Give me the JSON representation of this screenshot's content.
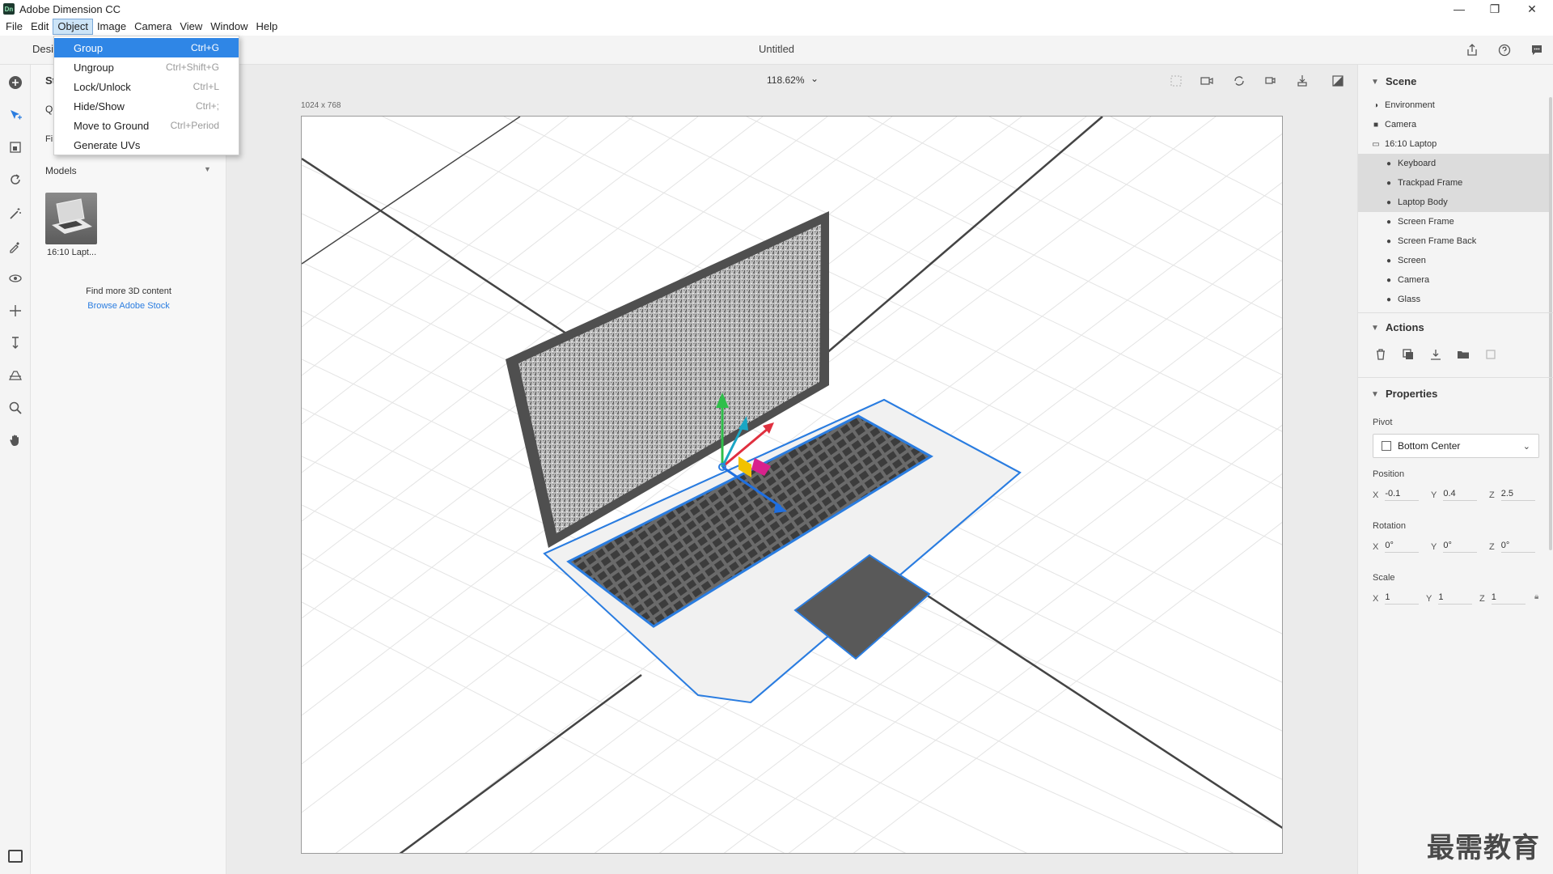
{
  "app": {
    "logo_text": "Dn",
    "title": "Adobe Dimension CC"
  },
  "window_controls": {
    "minimize": "—",
    "restore": "❐",
    "close": "✕"
  },
  "menubar": {
    "items": [
      "File",
      "Edit",
      "Object",
      "Image",
      "Camera",
      "View",
      "Window",
      "Help"
    ],
    "active": "Object"
  },
  "header": {
    "mode_tab": "Desi",
    "doc_title": "Untitled"
  },
  "object_menu": {
    "items": [
      {
        "label": "Group",
        "shortcut": "Ctrl+G",
        "highlighted": true
      },
      {
        "label": "Ungroup",
        "shortcut": "Ctrl+Shift+G"
      },
      {
        "label": "Lock/Unlock",
        "shortcut": "Ctrl+L"
      },
      {
        "label": "Hide/Show",
        "shortcut": "Ctrl+;"
      },
      {
        "label": "Move to Ground",
        "shortcut": "Ctrl+Period"
      },
      {
        "label": "Generate UVs",
        "shortcut": ""
      }
    ]
  },
  "starter_panel": {
    "ghost_title": "St",
    "ghost_search": "Q",
    "ghost_filter": "Fi",
    "models_header": "Models",
    "model_label": "16:10 Lapt...",
    "find_more": "Find more 3D content",
    "browse_stock": "Browse Adobe Stock"
  },
  "canvas": {
    "zoom": "118.62%",
    "zoom_caret": "⌄",
    "size_label": "1024 x 768"
  },
  "scene": {
    "title": "Scene",
    "rows": [
      {
        "label": "Environment",
        "icon": "environment-icon",
        "indent": 0,
        "selected": false
      },
      {
        "label": "Camera",
        "icon": "camera-icon",
        "indent": 0,
        "selected": false
      },
      {
        "label": "16:10 Laptop",
        "icon": "folder-icon",
        "indent": 0,
        "selected": false
      },
      {
        "label": "Keyboard",
        "icon": "object-icon",
        "indent": 1,
        "selected": true
      },
      {
        "label": "Trackpad Frame",
        "icon": "object-icon",
        "indent": 1,
        "selected": true
      },
      {
        "label": "Laptop Body",
        "icon": "object-icon",
        "indent": 1,
        "selected": true
      },
      {
        "label": "Screen Frame",
        "icon": "object-icon",
        "indent": 1,
        "selected": false
      },
      {
        "label": "Screen Frame Back",
        "icon": "object-icon",
        "indent": 1,
        "selected": false
      },
      {
        "label": "Screen",
        "icon": "object-icon",
        "indent": 1,
        "selected": false
      },
      {
        "label": "Camera",
        "icon": "object-icon",
        "indent": 1,
        "selected": false
      },
      {
        "label": "Glass",
        "icon": "object-icon",
        "indent": 1,
        "selected": false
      }
    ]
  },
  "actions": {
    "title": "Actions"
  },
  "properties": {
    "title": "Properties",
    "pivot_label": "Pivot",
    "pivot_value": "Bottom Center",
    "position_label": "Position",
    "position": {
      "x": "-0.1",
      "y": "0.4",
      "z": "2.5"
    },
    "rotation_label": "Rotation",
    "rotation": {
      "x": "0°",
      "y": "0°",
      "z": "0°"
    },
    "scale_label": "Scale",
    "scale": {
      "x": "1",
      "y": "1",
      "z": "1"
    },
    "axis": {
      "x": "X",
      "y": "Y",
      "z": "Z"
    }
  },
  "watermark": "最需教育",
  "colors": {
    "accent": "#2f86e6",
    "selection_outline": "#2b7de0",
    "gizmo_green": "#2fbf4a",
    "gizmo_red": "#e0303f",
    "gizmo_cyan": "#1aa6c4",
    "gizmo_yellow": "#f2c200",
    "gizmo_magenta": "#d8218c",
    "gizmo_blue": "#1f6fe0"
  }
}
